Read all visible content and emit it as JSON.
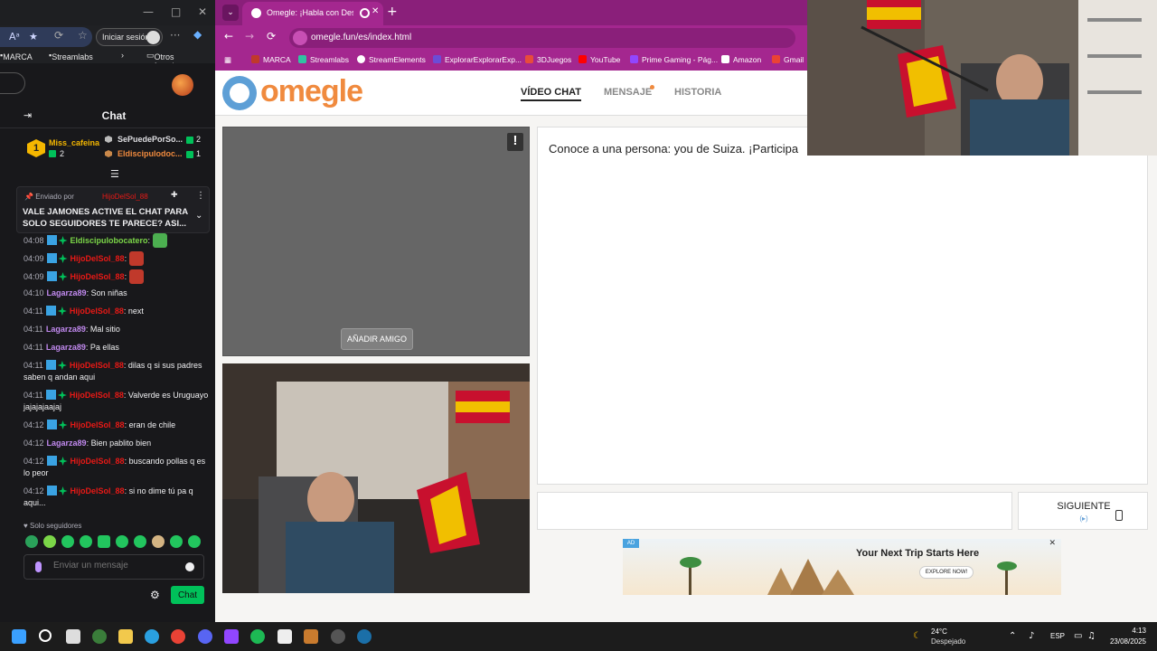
{
  "left_browser": {
    "window_controls": [
      "—",
      "□",
      "✕"
    ],
    "signin_label": "Iniciar sesión",
    "bookmarks": [
      "MARCA",
      "Streamlabs",
      "Otros favoritos"
    ]
  },
  "twitch": {
    "chat_title": "Chat",
    "leaderboard": {
      "rank": "1",
      "first_name": "Miss_cafeina",
      "first_count": "2",
      "others": [
        {
          "name": "SePuedePorSo...",
          "count": "2"
        },
        {
          "name": "Eldiscipulodoc...",
          "count": "1"
        }
      ]
    },
    "pinned": {
      "by_label": "Enviado por",
      "user": "HijoDelSol_88",
      "text": "VALE JAMONES ACTIVE EL CHAT PARA SOLO SEGUIDORES TE PARECE? ASI..."
    },
    "messages": [
      {
        "time": "04:08",
        "user": "Eldiscipulobocatero",
        "color": "#7bd648",
        "text": "",
        "badges": 2
      },
      {
        "time": "04:09",
        "user": "HijoDelSol_88",
        "color": "#e91916",
        "text": "",
        "badges": 2
      },
      {
        "time": "04:09",
        "user": "HijoDelSol_88",
        "color": "#e91916",
        "text": "",
        "badges": 2
      },
      {
        "time": "04:10",
        "user": "Lagarza89",
        "color": "#c28af0",
        "text": "Son niñas",
        "badges": 0
      },
      {
        "time": "04:11",
        "user": "HijoDelSol_88",
        "color": "#e91916",
        "text": "next",
        "badges": 2
      },
      {
        "time": "04:11",
        "user": "Lagarza89",
        "color": "#c28af0",
        "text": "Mal sitio",
        "badges": 0
      },
      {
        "time": "04:11",
        "user": "Lagarza89",
        "color": "#c28af0",
        "text": "Pa ellas",
        "badges": 0
      },
      {
        "time": "04:11",
        "user": "HijoDelSol_88",
        "color": "#e91916",
        "text": "dilas q si sus padres saben q andan aqui",
        "badges": 2
      },
      {
        "time": "04:11",
        "user": "HijoDelSol_88",
        "color": "#e91916",
        "text": "Valverde es Uruguayo jajajajaajaj",
        "badges": 2
      },
      {
        "time": "04:12",
        "user": "HijoDelSol_88",
        "color": "#e91916",
        "text": "eran de chile",
        "badges": 2
      },
      {
        "time": "04:12",
        "user": "Lagarza89",
        "color": "#c28af0",
        "text": "Bien pablito bien",
        "badges": 0
      },
      {
        "time": "04:12",
        "user": "HijoDelSol_88",
        "color": "#e91916",
        "text": "buscando pollas q es lo peor",
        "badges": 2
      },
      {
        "time": "04:12",
        "user": "HijoDelSol_88",
        "color": "#e91916",
        "text": "si no dime tú pa q aqui...",
        "badges": 2
      }
    ],
    "followers_only": "Solo seguidores",
    "input_placeholder": "Enviar un mensaje",
    "send_label": "Chat"
  },
  "omegle_browser": {
    "tab_title": "Omegle: ¡Habla con Descon",
    "url": "omegle.fun/es/index.html",
    "bookmarks": [
      "MARCA",
      "Streamlabs",
      "StreamElements",
      "ExplorarExplorarExp...",
      "3DJuegos",
      "YouTube",
      "Prime Gaming - Pág...",
      "Amazon",
      "Gmail"
    ],
    "logo": "omegle",
    "nav": {
      "video": "VÍDEO CHAT",
      "message": "MENSAJE",
      "history": "HISTORIA"
    },
    "report_label": "!",
    "add_friend": "AÑADIR AMIGO",
    "chat_intro": "Conoce a una persona: you de Suiza. ¡Participa",
    "next_label": "SIGUIENTE",
    "next_key": "(▸)",
    "ad": {
      "badge": "AD",
      "title": "Your Next Trip Starts Here",
      "cta": "EXPLORE NOW!"
    }
  },
  "taskbar": {
    "temp": "24°C",
    "weather": "Despejado",
    "lang": "ESP",
    "time": "4:13",
    "date": "23/08/2025"
  }
}
